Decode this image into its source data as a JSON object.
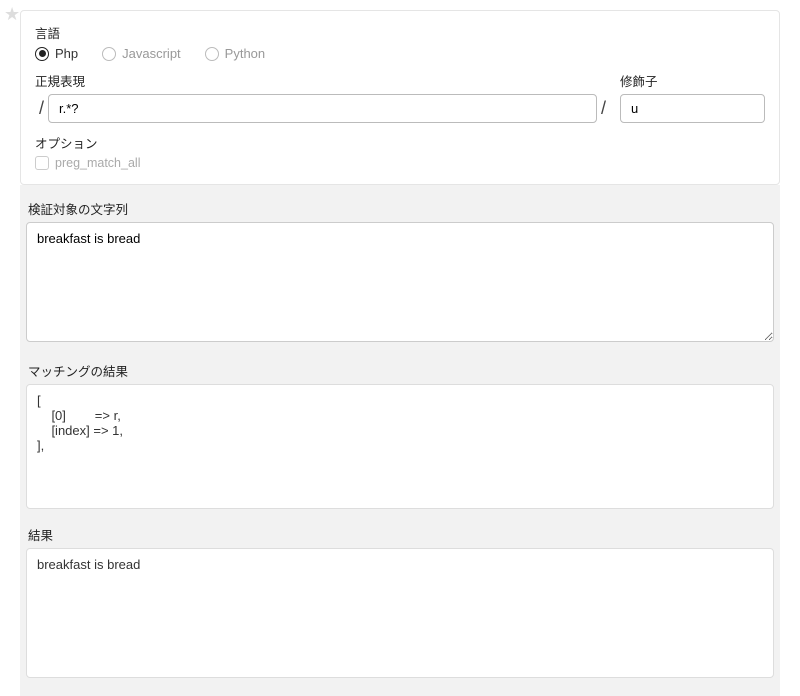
{
  "star_icon": "★",
  "language": {
    "label": "言語",
    "options": [
      {
        "label": "Php",
        "selected": true
      },
      {
        "label": "Javascript",
        "selected": false
      },
      {
        "label": "Python",
        "selected": false
      }
    ]
  },
  "regex": {
    "label": "正規表現",
    "pattern": "r.*?",
    "slash": "/",
    "modifier_label": "修飾子",
    "modifier": "u"
  },
  "options": {
    "label": "オプション",
    "preg_match_all_label": "preg_match_all",
    "preg_match_all_checked": false
  },
  "test_string": {
    "label": "検証対象の文字列",
    "value": "breakfast is bread"
  },
  "match_result": {
    "label": "マッチングの結果",
    "text": "[\n    [0]        => r,\n    [index] => 1,\n],"
  },
  "result": {
    "label": "結果",
    "text": "breakfast is bread"
  }
}
